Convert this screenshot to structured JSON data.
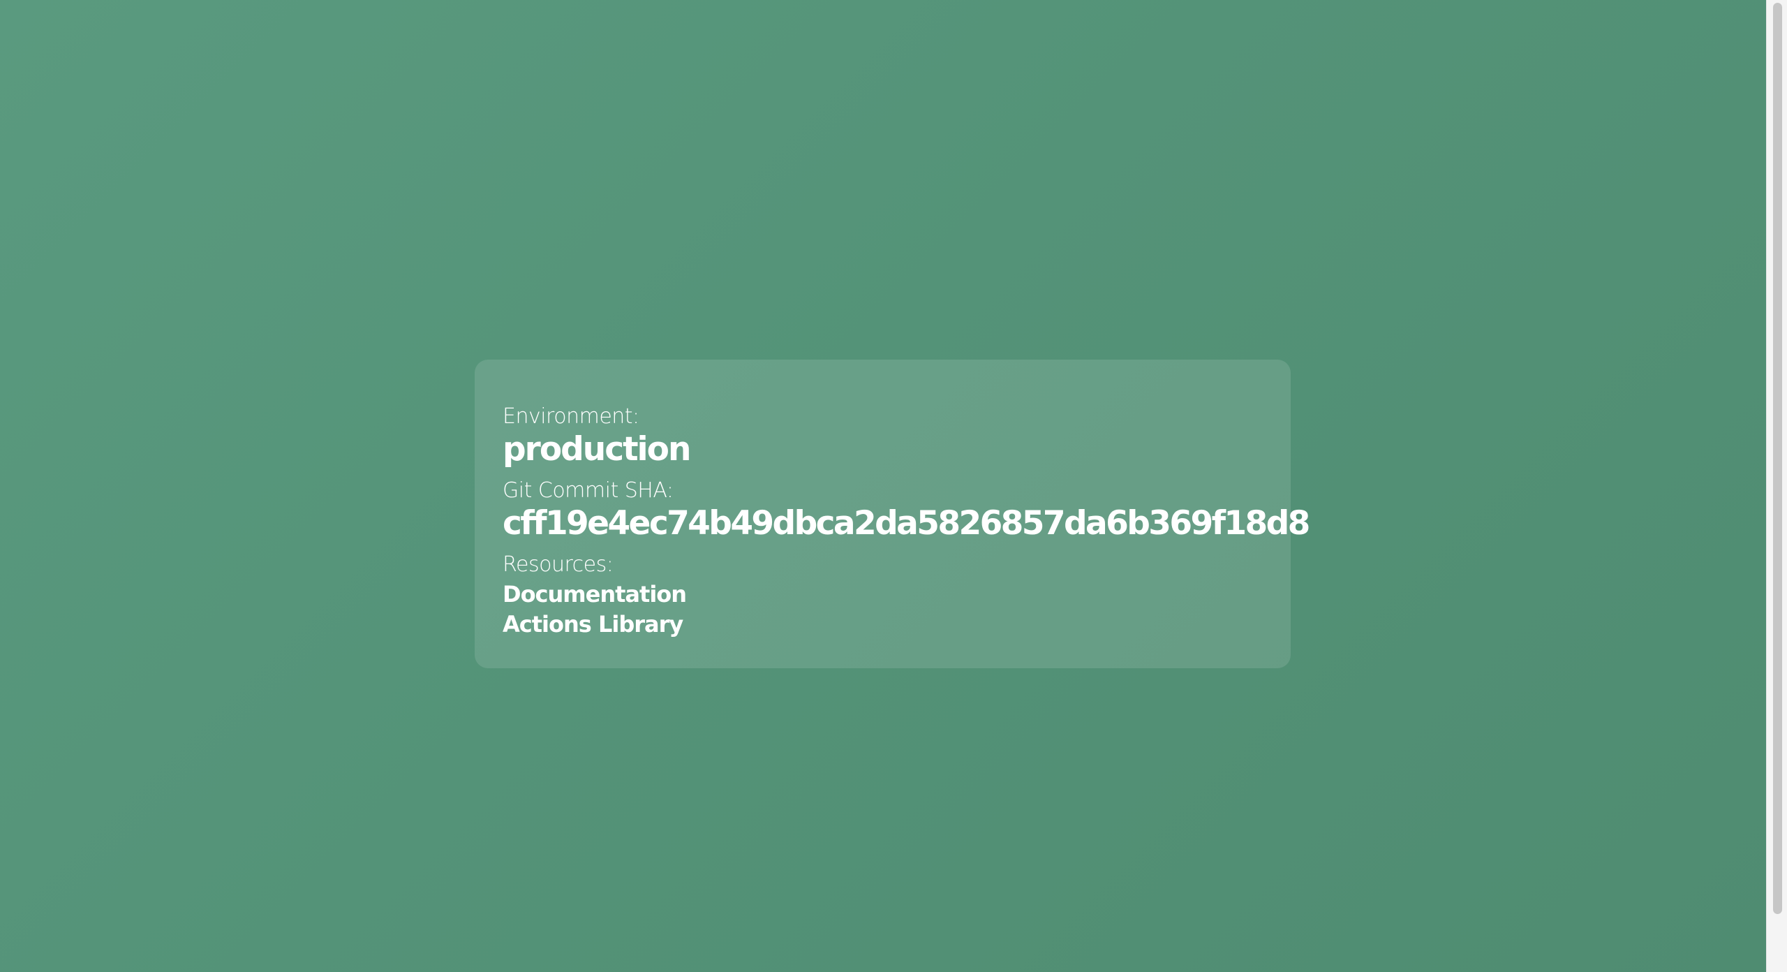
{
  "environment": {
    "label": "Environment:",
    "value": "production"
  },
  "commit": {
    "label": "Git Commit SHA:",
    "value": "cff19e4ec74b49dbca2da5826857da6b369f18d8"
  },
  "resources": {
    "label": "Resources:",
    "links": [
      {
        "label": "Documentation"
      },
      {
        "label": "Actions Library"
      }
    ]
  },
  "colors": {
    "background": "#549378",
    "card": "#66a088",
    "text": "#ffffff"
  }
}
